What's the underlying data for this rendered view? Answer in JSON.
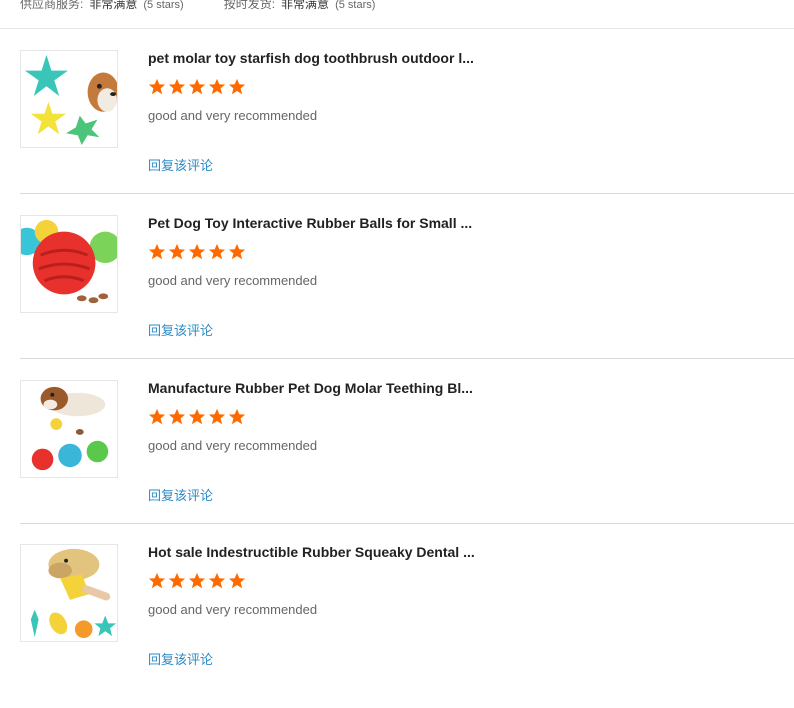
{
  "top_ratings": [
    {
      "label": "供应商服务:",
      "value": "非常满意",
      "stars": "(5 stars)"
    },
    {
      "label": "按时发货:",
      "value": "非常满意",
      "stars": "(5 stars)"
    }
  ],
  "colors": {
    "star": "#ff6a00",
    "link": "#2c8bc6",
    "divider": "#d9d9d9"
  },
  "reviews": [
    {
      "title": "pet molar toy starfish dog toothbrush outdoor l...",
      "rating": 5,
      "comment": "good and very recommended",
      "reply_label": "回复该评论",
      "image": "starfish-dog-toy-image"
    },
    {
      "title": "Pet Dog Toy Interactive Rubber Balls for Small ...",
      "rating": 5,
      "comment": "good and very recommended",
      "reply_label": "回复该评论",
      "image": "rubber-ball-dog-toy-image"
    },
    {
      "title": "Manufacture Rubber Pet Dog Molar Teething Bl...",
      "rating": 5,
      "comment": "good and very recommended",
      "reply_label": "回复该评论",
      "image": "teething-ball-dog-toy-image"
    },
    {
      "title": "Hot sale Indestructible Rubber Squeaky Dental ...",
      "rating": 5,
      "comment": "good and very recommended",
      "reply_label": "回复该评论",
      "image": "squeaky-dental-toy-image"
    }
  ]
}
